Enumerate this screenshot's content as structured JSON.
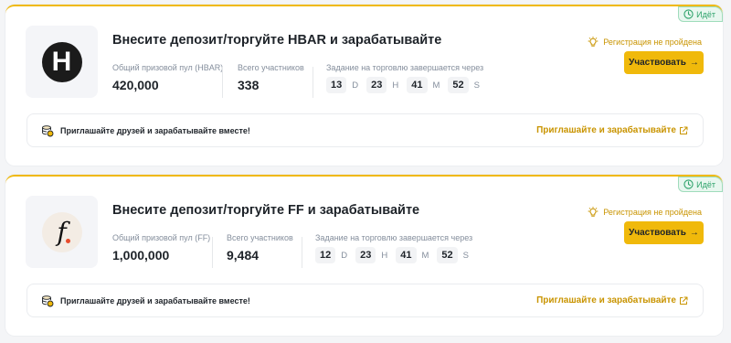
{
  "cards": [
    {
      "status": "Идёт",
      "title": "Внесите депозит/торгуйте HBAR и зарабатывайте",
      "logo_letter": "H",
      "prize_pool_label": "Общий призовой пул (HBAR)",
      "prize_pool_value": "420,000",
      "participants_label": "Всего участников",
      "participants_value": "338",
      "timer_label": "Задание на торговлю завершается через",
      "timer": {
        "d": "13",
        "d_unit": "D",
        "h": "23",
        "h_unit": "H",
        "m": "41",
        "m_unit": "M",
        "s": "52",
        "s_unit": "S"
      },
      "registration": "Регистрация не пройдена",
      "join_label": "Участвовать",
      "join_arrow": "→",
      "invite_text": "Приглашайте друзей и зарабатывайте вместе!",
      "invite_link": "Приглашайте и зарабатывайте"
    },
    {
      "status": "Идёт",
      "title": "Внесите депозит/торгуйте FF и зарабатывайте",
      "logo_letter": "f",
      "prize_pool_label": "Общий призовой пул (FF)",
      "prize_pool_value": "1,000,000",
      "participants_label": "Всего участников",
      "participants_value": "9,484",
      "timer_label": "Задание на торговлю завершается через",
      "timer": {
        "d": "12",
        "d_unit": "D",
        "h": "23",
        "h_unit": "H",
        "m": "41",
        "m_unit": "M",
        "s": "52",
        "s_unit": "S"
      },
      "registration": "Регистрация не пройдена",
      "join_label": "Участвовать",
      "join_arrow": "→",
      "invite_text": "Приглашайте друзей и зарабатывайте вместе!",
      "invite_link": "Приглашайте и зарабатывайте"
    }
  ],
  "colors": {
    "accent": "#f0b90b",
    "status_green": "#2ea36b",
    "link_gold": "#c99400"
  },
  "icons": [
    "clock-icon",
    "bulb-icon",
    "coin-stack-icon",
    "external-link-icon"
  ]
}
